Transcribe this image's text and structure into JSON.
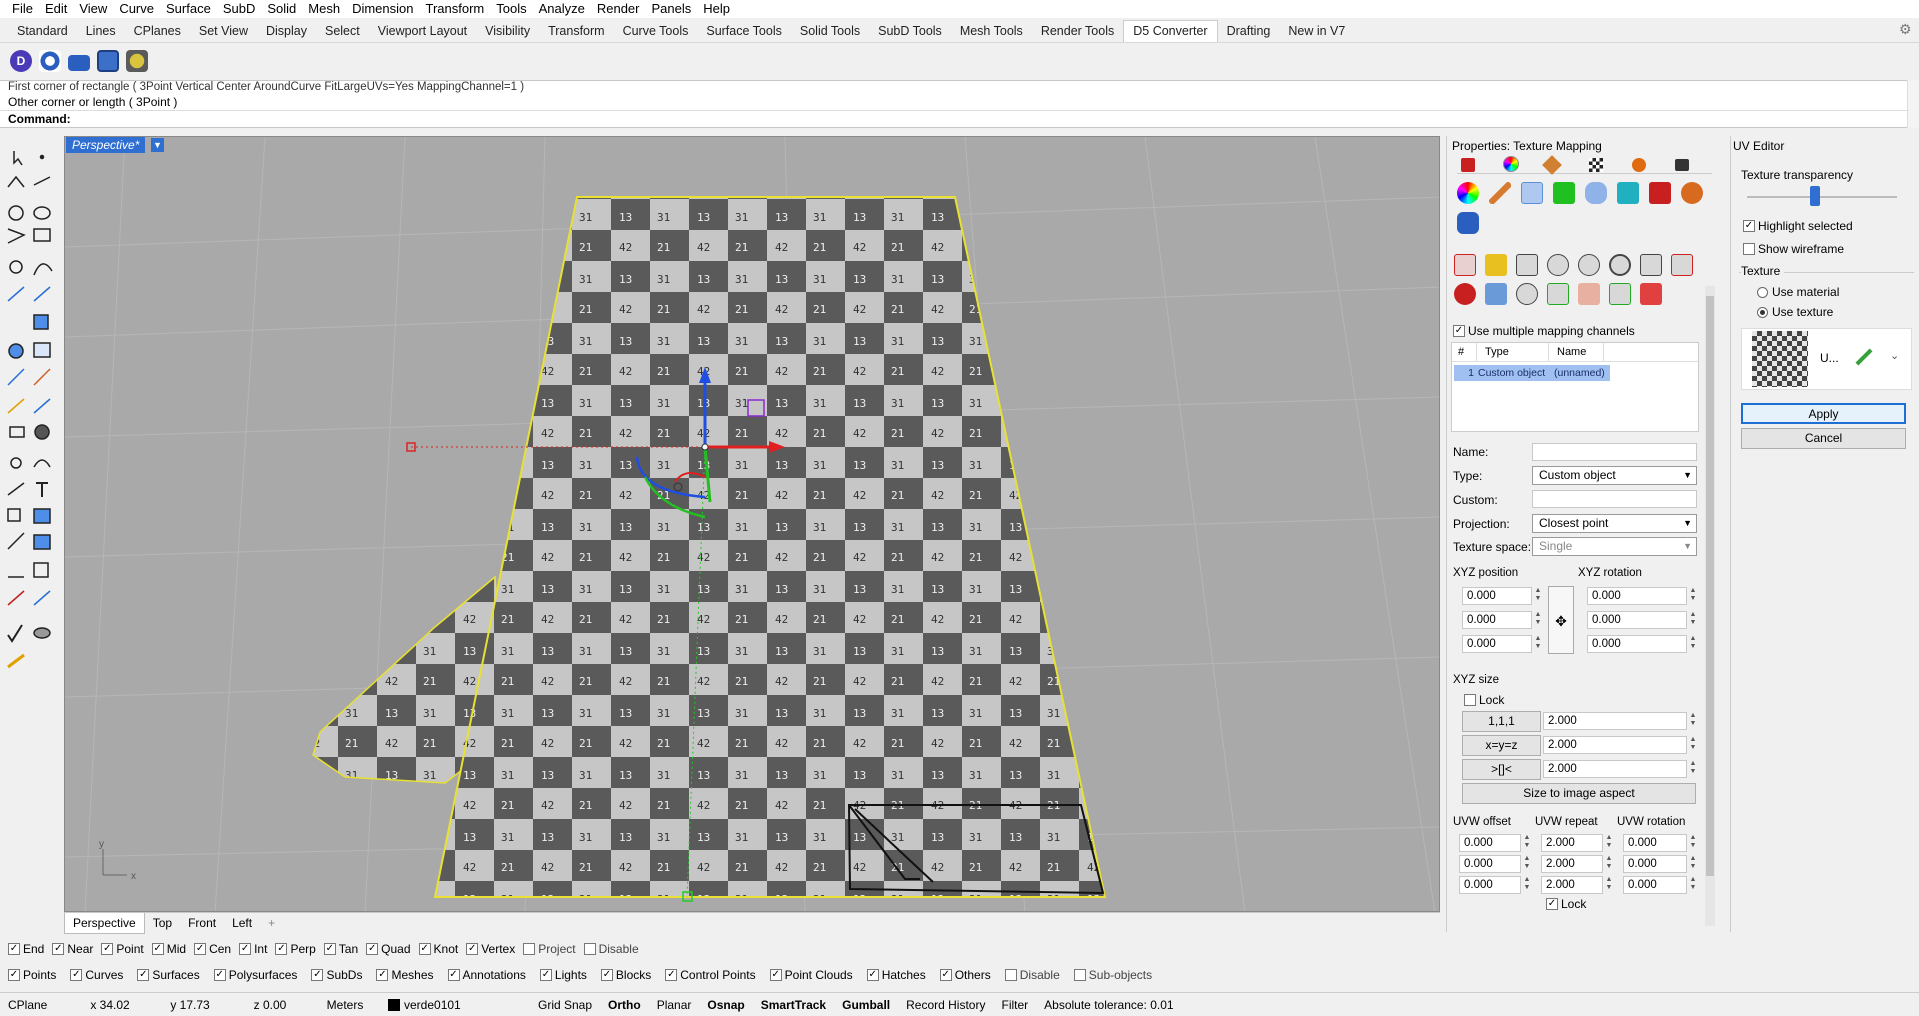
{
  "menu": [
    "File",
    "Edit",
    "View",
    "Curve",
    "Surface",
    "SubD",
    "Solid",
    "Mesh",
    "Dimension",
    "Transform",
    "Tools",
    "Analyze",
    "Render",
    "Panels",
    "Help"
  ],
  "tabs": [
    "Standard",
    "Lines",
    "CPlanes",
    "Set View",
    "Display",
    "Select",
    "Viewport Layout",
    "Visibility",
    "Transform",
    "Curve Tools",
    "Surface Tools",
    "Solid Tools",
    "SubD Tools",
    "Mesh Tools",
    "Render Tools",
    "D5 Converter",
    "Drafting",
    "New in V7"
  ],
  "active_tab": "D5 Converter",
  "command": {
    "line1": "First corner of rectangle ( 3Point  Vertical  Center  AroundCurve  FitLargeUVs=Yes  MappingChannel=1 )",
    "line2": "Other corner or length ( 3Point )",
    "prompt": "Command:"
  },
  "viewport": {
    "title": "Perspective*",
    "tabs": [
      "Perspective",
      "Top",
      "Front",
      "Left"
    ],
    "add_tab": "+",
    "axis_y": "y",
    "axis_x": "x"
  },
  "osnaps": [
    {
      "label": "End",
      "checked": true
    },
    {
      "label": "Near",
      "checked": true
    },
    {
      "label": "Point",
      "checked": true
    },
    {
      "label": "Mid",
      "checked": true
    },
    {
      "label": "Cen",
      "checked": true
    },
    {
      "label": "Int",
      "checked": true
    },
    {
      "label": "Perp",
      "checked": true
    },
    {
      "label": "Tan",
      "checked": true
    },
    {
      "label": "Quad",
      "checked": true
    },
    {
      "label": "Knot",
      "checked": true
    },
    {
      "label": "Vertex",
      "checked": true
    },
    {
      "label": "Project",
      "checked": false
    },
    {
      "label": "Disable",
      "checked": false
    }
  ],
  "filters": [
    {
      "label": "Points",
      "checked": true
    },
    {
      "label": "Curves",
      "checked": true
    },
    {
      "label": "Surfaces",
      "checked": true
    },
    {
      "label": "Polysurfaces",
      "checked": true
    },
    {
      "label": "SubDs",
      "checked": true
    },
    {
      "label": "Meshes",
      "checked": true
    },
    {
      "label": "Annotations",
      "checked": true
    },
    {
      "label": "Lights",
      "checked": true
    },
    {
      "label": "Blocks",
      "checked": true
    },
    {
      "label": "Control Points",
      "checked": true
    },
    {
      "label": "Point Clouds",
      "checked": true
    },
    {
      "label": "Hatches",
      "checked": true
    },
    {
      "label": "Others",
      "checked": true
    },
    {
      "label": "Disable",
      "checked": false
    },
    {
      "label": "Sub-objects",
      "checked": false
    }
  ],
  "status": {
    "cplane": "CPlane",
    "x": "x 34.02",
    "y": "y 17.73",
    "z": "z 0.00",
    "units": "Meters",
    "layer": "verde0101",
    "layer_color": "#000000",
    "items": [
      {
        "label": "Grid Snap",
        "bold": false
      },
      {
        "label": "Ortho",
        "bold": true
      },
      {
        "label": "Planar",
        "bold": false
      },
      {
        "label": "Osnap",
        "bold": true
      },
      {
        "label": "SmartTrack",
        "bold": true
      },
      {
        "label": "Gumball",
        "bold": true
      },
      {
        "label": "Record History",
        "bold": false
      },
      {
        "label": "Filter",
        "bold": false
      }
    ],
    "tolerance": "Absolute tolerance: 0.01"
  },
  "properties": {
    "title": "Properties: Texture Mapping",
    "use_multiple": "Use multiple mapping channels",
    "table_headers": [
      "#",
      "Type",
      "Name"
    ],
    "table_row": {
      "num": "1",
      "type": "Custom object",
      "name": "(unnamed)"
    },
    "name_label": "Name:",
    "name_value": "",
    "type_label": "Type:",
    "type_value": "Custom object",
    "custom_label": "Custom:",
    "custom_value": "",
    "projection_label": "Projection:",
    "projection_value": "Closest point",
    "texspace_label": "Texture space:",
    "texspace_value": "Single",
    "xyz_position": "XYZ position",
    "xyz_rotation": "XYZ rotation",
    "pos": [
      "0.000",
      "0.000",
      "0.000"
    ],
    "rot": [
      "0.000",
      "0.000",
      "0.000"
    ],
    "xyz_size": "XYZ size",
    "lock": "Lock",
    "size_buttons": [
      "1,1,1",
      "x=y=z",
      ">[]<"
    ],
    "size_values": [
      "2.000",
      "2.000",
      "2.000"
    ],
    "size_to_image": "Size to image aspect",
    "uvw_offset": "UVW offset",
    "uvw_repeat": "UVW repeat",
    "uvw_rotation": "UVW rotation",
    "offset": [
      "0.000",
      "0.000",
      "0.000"
    ],
    "repeat": [
      "2.000",
      "2.000",
      "2.000"
    ],
    "rotation": [
      "0.000",
      "0.000",
      "0.000"
    ],
    "lock2": "Lock"
  },
  "uv_editor": {
    "title": "UV Editor",
    "transparency": "Texture transparency",
    "transparency_value": 0.45,
    "highlight_selected": "Highlight selected",
    "show_wireframe": "Show wireframe",
    "texture_label": "Texture",
    "use_material": "Use material",
    "use_texture": "Use texture",
    "texture_name": "U...",
    "apply": "Apply",
    "cancel": "Cancel"
  }
}
